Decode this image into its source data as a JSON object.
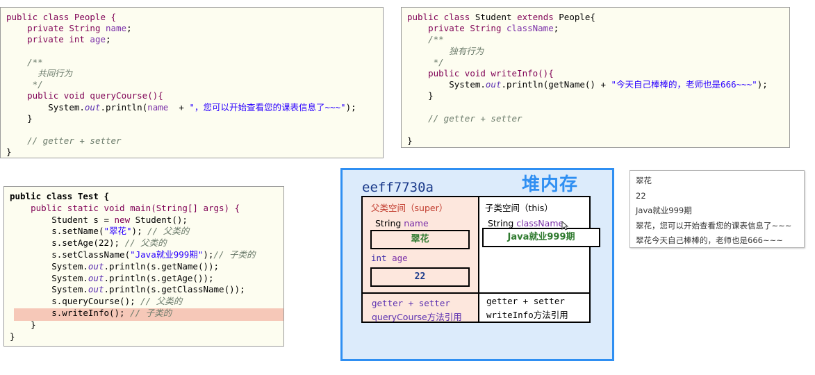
{
  "people_class": {
    "l1": "public class People {",
    "l2_a": "private String ",
    "l2_b": "name",
    "l2_c": ";",
    "l3_a": "private int ",
    "l3_b": "age",
    "l3_c": ";",
    "l4": "/**",
    "l5": "共同行为",
    "l6": "*/",
    "l7": "public void queryCourse(){",
    "l8_a": "System.",
    "l8_b": "out",
    "l8_c": ".println(",
    "l8_d": "name",
    "l8_e": "  + ",
    "l8_f": "\"，您可以开始查看您的课表信息了~~~\"",
    "l8_g": ");",
    "l9": "}",
    "l10": "// getter + setter",
    "l11": "}"
  },
  "student_class": {
    "l1_a": "public class ",
    "l1_b": "Student ",
    "l1_c": "extends ",
    "l1_d": "People{",
    "l2_a": "private String ",
    "l2_b": "className",
    "l2_c": ";",
    "l3": "/**",
    "l4": "独有行为",
    "l5": "*/",
    "l6": "public void writeInfo(){",
    "l7_a": "System.",
    "l7_b": "out",
    "l7_c": ".println(getName() + ",
    "l7_d": "\"今天自己棒棒的，老师也是666~~~\"",
    "l7_e": ");",
    "l8": "}",
    "l9": "// getter + setter",
    "l10": "}"
  },
  "test_class": {
    "l1": "public class Test {",
    "l2": "public static void main(String[] args) {",
    "l3_a": "Student s = ",
    "l3_b": "new ",
    "l3_c": "Student();",
    "l4_a": "s.setName(",
    "l4_b": "\"翠花\"",
    "l4_c": "); ",
    "l4_d": "// 父类的",
    "l5_a": "s.setAge(22); ",
    "l5_b": "// 父类的",
    "l6_a": "s.setClassName(",
    "l6_b": "\"Java就业999期\"",
    "l6_c": ");",
    "l6_d": "// 子类的",
    "l7_a": "System.",
    "l7_b": "out",
    "l7_c": ".println(s.getName());",
    "l8_a": "System.",
    "l8_b": "out",
    "l8_c": ".println(s.getAge());",
    "l9_a": "System.",
    "l9_b": "out",
    "l9_c": ".println(s.getClassName());",
    "l10_a": "s.queryCourse(); ",
    "l10_b": "// 父类的",
    "l11_a": "s.writeInfo(); ",
    "l11_b": "// 子类的",
    "l12": "}",
    "l13": "}"
  },
  "heap": {
    "address": "eeff7730a",
    "title": "堆内存",
    "super_label_a": "父类空间（",
    "super_label_b": "super",
    "super_label_c": "）",
    "this_label_a": "子类空间（",
    "this_label_b": "this",
    "this_label_c": "）",
    "field_name_type": "String ",
    "field_name": "name",
    "field_name_value": "翠花",
    "field_age_type": "int",
    "field_age": "age",
    "field_age_value": "22",
    "field_classname_type": "String ",
    "field_classname": "className",
    "field_classname_value": "Java就业999期",
    "super_methods_1": "getter + setter",
    "super_methods_2": "queryCourse方法引用",
    "this_methods_1": "getter + setter",
    "this_methods_2": "writeInfo方法引用"
  },
  "console": {
    "lines": [
      "翠花",
      "22",
      "Java就业999期",
      "翠花，您可以开始查看您的课表信息了~~~",
      "翠花今天自己棒棒的，老师也是666~~~"
    ]
  }
}
